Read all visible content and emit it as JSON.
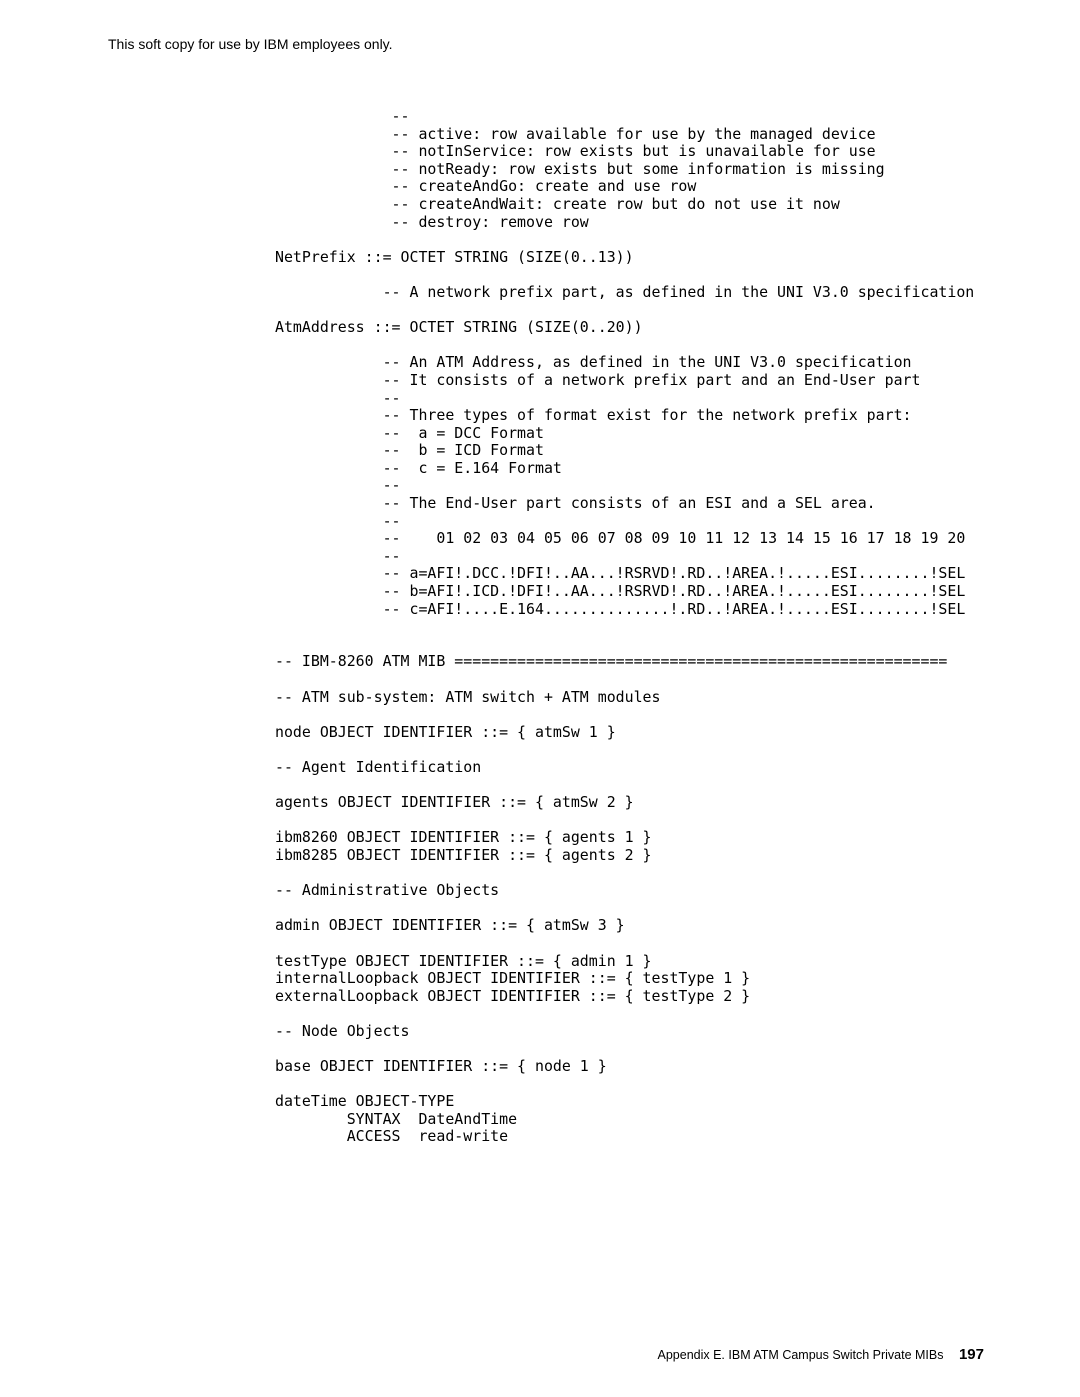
{
  "header_note": "This soft copy for use by IBM employees only.",
  "code": {
    "l01": "             --",
    "l02": "             -- active: row available for use by the managed device",
    "l03": "             -- notInService: row exists but is unavailable for use",
    "l04": "             -- notReady: row exists but some information is missing",
    "l05": "             -- createAndGo: create and use row",
    "l06": "             -- createAndWait: create row but do not use it now",
    "l07": "             -- destroy: remove row",
    "l08": "",
    "l09": "NetPrefix ::= OCTET STRING (SIZE(0..13))",
    "l10": "",
    "l11": "            -- A network prefix part, as defined in the UNI V3.0 specification",
    "l12": "",
    "l13": "AtmAddress ::= OCTET STRING (SIZE(0..20))",
    "l14": "",
    "l15": "            -- An ATM Address, as defined in the UNI V3.0 specification",
    "l16": "            -- It consists of a network prefix part and an End-User part",
    "l17": "            --",
    "l18": "            -- Three types of format exist for the network prefix part:",
    "l19": "            --  a = DCC Format",
    "l20": "            --  b = ICD Format",
    "l21": "            --  c = E.164 Format",
    "l22": "            --",
    "l23": "            -- The End-User part consists of an ESI and a SEL area.",
    "l24": "            --",
    "l25": "            --    01 02 03 04 05 06 07 08 09 10 11 12 13 14 15 16 17 18 19 20",
    "l26": "            --",
    "l27": "            -- a=AFI!.DCC.!DFI!..AA...!RSRVD!.RD..!AREA.!.....ESI........!SEL",
    "l28": "            -- b=AFI!.ICD.!DFI!..AA...!RSRVD!.RD..!AREA.!.....ESI........!SEL",
    "l29": "            -- c=AFI!....E.164..............!.RD..!AREA.!.....ESI........!SEL",
    "l30": "",
    "l31": "",
    "l32": "-- IBM-8260 ATM MIB =======================================================",
    "l33": "",
    "l34": "-- ATM sub-system: ATM switch + ATM modules",
    "l35": "",
    "l36": "node OBJECT IDENTIFIER ::= { atmSw 1 }",
    "l37": "",
    "l38": "-- Agent Identification",
    "l39": "",
    "l40": "agents OBJECT IDENTIFIER ::= { atmSw 2 }",
    "l41": "",
    "l42": "ibm8260 OBJECT IDENTIFIER ::= { agents 1 }",
    "l43": "ibm8285 OBJECT IDENTIFIER ::= { agents 2 }",
    "l44": "",
    "l45": "-- Administrative Objects",
    "l46": "",
    "l47": "admin OBJECT IDENTIFIER ::= { atmSw 3 }",
    "l48": "",
    "l49": "testType OBJECT IDENTIFIER ::= { admin 1 }",
    "l50": "internalLoopback OBJECT IDENTIFIER ::= { testType 1 }",
    "l51": "externalLoopback OBJECT IDENTIFIER ::= { testType 2 }",
    "l52": "",
    "l53": "-- Node Objects",
    "l54": "",
    "l55": "base OBJECT IDENTIFIER ::= { node 1 }",
    "l56": "",
    "l57": "dateTime OBJECT-TYPE",
    "l58": "        SYNTAX  DateAndTime",
    "l59": "        ACCESS  read-write"
  },
  "footer": {
    "section": "Appendix E.  IBM ATM Campus Switch Private MIBs",
    "page": "197"
  }
}
